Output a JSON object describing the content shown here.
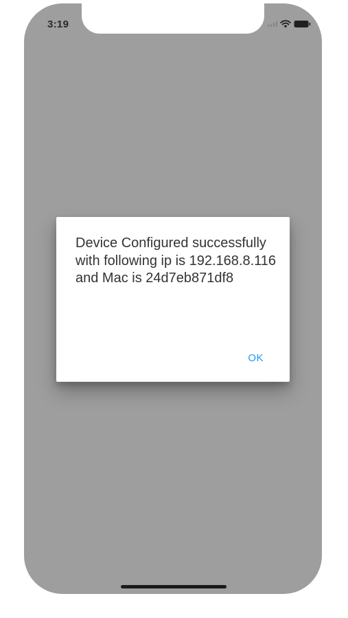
{
  "status_bar": {
    "time": "3:19",
    "icons": [
      "cellular-signal-icon",
      "wifi-icon",
      "battery-icon"
    ]
  },
  "alert": {
    "message": "Device Configured successfully with following ip is 192.168.8.116 and Mac is 24d7eb871df8",
    "ok_label": "OK"
  },
  "colors": {
    "screen_overlay": "#9e9e9e",
    "dialog_background": "#ffffff",
    "message_text": "#333333",
    "ok_accent": "#2196f3"
  }
}
